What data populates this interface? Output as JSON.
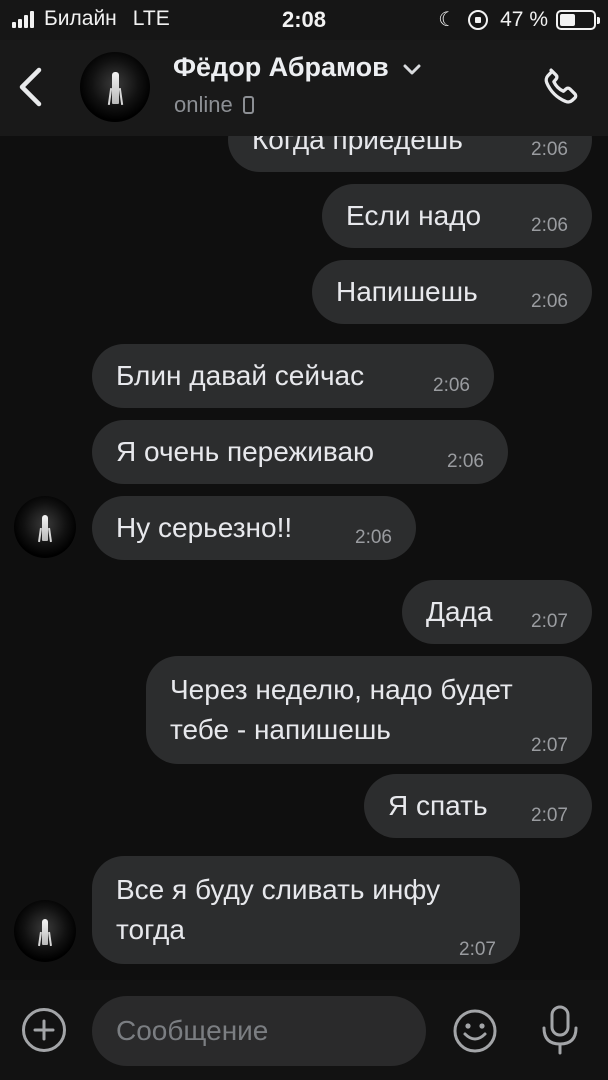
{
  "status_bar": {
    "carrier": "Билайн",
    "network": "LTE",
    "time": "2:08",
    "battery": "47 %",
    "battery_level": 0.47
  },
  "header": {
    "contact_name": "Фёдор Абрамов",
    "status": "online"
  },
  "messages": [
    {
      "side": "out",
      "text": "Когда приедешь",
      "time": "2:06"
    },
    {
      "side": "out",
      "text": "Если надо",
      "time": "2:06"
    },
    {
      "side": "out",
      "text": "Напишешь",
      "time": "2:06"
    },
    {
      "side": "in",
      "text": "Блин давай сейчас",
      "time": "2:06"
    },
    {
      "side": "in",
      "text": "Я очень переживаю",
      "time": "2:06"
    },
    {
      "side": "in",
      "text": "Ну серьезно!!",
      "time": "2:06"
    },
    {
      "side": "out",
      "text": "Дада",
      "time": "2:07"
    },
    {
      "side": "out",
      "text": "Через неделю, надо будет тебе - напишешь",
      "time": "2:07"
    },
    {
      "side": "out",
      "text": "Я спать",
      "time": "2:07"
    },
    {
      "side": "in",
      "text": "Все я буду сливать инфу тогда",
      "time": "2:07"
    }
  ],
  "composer": {
    "placeholder": "Сообщение"
  },
  "icons": {
    "back": "chevron-left-icon",
    "call": "phone-icon",
    "attach": "plus-circle-icon",
    "emoji": "smile-icon",
    "mic": "microphone-icon"
  }
}
